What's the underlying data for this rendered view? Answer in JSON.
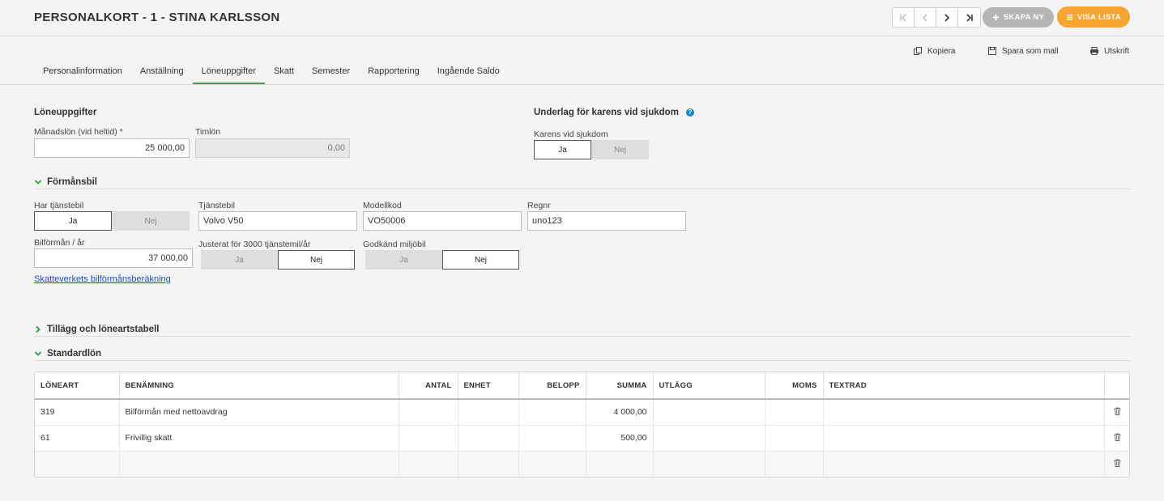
{
  "header": {
    "title": "PERSONALKORT - 1 - STINA KARLSSON",
    "create_label": "SKAPA NY",
    "list_label": "VISA LISTA"
  },
  "actions": {
    "copy": "Kopiera",
    "save_template": "Spara som mall",
    "print": "Utskrift"
  },
  "tabs": [
    {
      "label": "Personalinformation",
      "active": false
    },
    {
      "label": "Anställning",
      "active": false
    },
    {
      "label": "Löneuppgifter",
      "active": true
    },
    {
      "label": "Skatt",
      "active": false
    },
    {
      "label": "Semester",
      "active": false
    },
    {
      "label": "Rapportering",
      "active": false
    },
    {
      "label": "Ingående Saldo",
      "active": false
    }
  ],
  "salary": {
    "heading": "Löneuppgifter",
    "monthly_label": "Månadslön (vid heltid) *",
    "monthly_value": "25 000,00",
    "hourly_label": "Timlön",
    "hourly_value": "0,00"
  },
  "karens": {
    "heading": "Underlag för karens vid sjukdom",
    "help": "?",
    "label": "Karens vid sjukdom",
    "yes": "Ja",
    "no": "Nej",
    "selected": "Ja"
  },
  "car": {
    "heading": "Förmånsbil",
    "has_car_label": "Har tjänstebil",
    "has_car_yes": "Ja",
    "has_car_no": "Nej",
    "car_label": "Tjänstebil",
    "car_value": "Volvo V50",
    "model_label": "Modellkod",
    "model_value": "VO50006",
    "reg_label": "Regnr",
    "reg_value": "uno123",
    "benefit_label": "Bilförmån / år",
    "benefit_value": "37 000,00",
    "adjusted_label": "Justerat för 3000 tjänstemil/år",
    "adjusted_yes": "Ja",
    "adjusted_no": "Nej",
    "eco_label": "Godkänd miljöbil",
    "eco_yes": "Ja",
    "eco_no": "Nej",
    "link": "Skatteverkets bilförmånsberäkning"
  },
  "sections": {
    "supplements": "Tillägg och löneartstabell",
    "standard": "Standardlön"
  },
  "table": {
    "columns": [
      "LÖNEART",
      "BENÄMNING",
      "ANTAL",
      "ENHET",
      "BELOPP",
      "SUMMA",
      "UTLÄGG",
      "MOMS",
      "TEXTRAD"
    ],
    "rows": [
      {
        "code": "319",
        "name": "Bilförmån med nettoavdrag",
        "qty": "",
        "unit": "",
        "amount": "",
        "sum": "4 000,00",
        "outlay": "",
        "vat": "",
        "text": ""
      },
      {
        "code": "61",
        "name": "Frivillig skatt",
        "qty": "",
        "unit": "",
        "amount": "",
        "sum": "500,00",
        "outlay": "",
        "vat": "",
        "text": ""
      }
    ]
  },
  "colors": {
    "accent_green": "#3aa54a",
    "orange": "#f7a531",
    "grey_button": "#b5b5b5",
    "link_blue": "#1a4fbf"
  }
}
